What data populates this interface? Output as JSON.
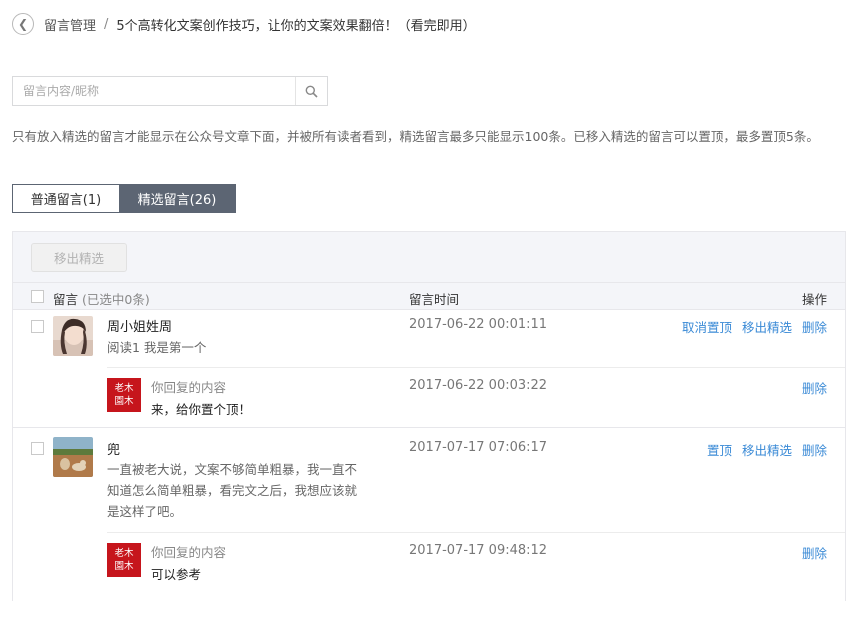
{
  "breadcrumb": {
    "parent": "留言管理",
    "separator": "/",
    "current": "5个高转化文案创作技巧，让你的文案效果翻倍！（看完即用）"
  },
  "search": {
    "placeholder": "留言内容/昵称",
    "value": ""
  },
  "notice": "只有放入精选的留言才能显示在公众号文章下面，并被所有读者看到，精选留言最多只能显示100条。已移入精选的留言可以置顶，最多置顶5条。",
  "tabs": [
    {
      "label": "普通留言(1)",
      "active": false
    },
    {
      "label": "精选留言(26)",
      "active": true
    }
  ],
  "toolbar": {
    "remove_label": "移出精选"
  },
  "table": {
    "header_message": "留言",
    "header_selected": "(已选中0条)",
    "header_time": "留言时间",
    "header_ops": "操作"
  },
  "comments": [
    {
      "nickname": "周小姐姓周",
      "message": "阅读1 我是第一个",
      "time": "2017-06-22 00:01:11",
      "ops": [
        "取消置顶",
        "移出精选",
        "删除"
      ],
      "reply": {
        "avatar_text": [
          "老木",
          "園木"
        ],
        "label": "你回复的内容",
        "text": "来，给你置个顶！",
        "time": "2017-06-22 00:03:22",
        "op": "删除"
      }
    },
    {
      "nickname": "兜",
      "message_lines": [
        "一直被老大说，文案不够简单粗暴，我一直不",
        "知道怎么简单粗暴，看完文之后，我想应该就",
        "是这样了吧。"
      ],
      "time": "2017-07-17 07:06:17",
      "ops": [
        "置顶",
        "移出精选",
        "删除"
      ],
      "reply": {
        "avatar_text": [
          "老木",
          "園木"
        ],
        "label": "你回复的内容",
        "text": "可以参考",
        "time": "2017-07-17 09:48:12",
        "op": "删除"
      }
    }
  ],
  "colors": {
    "tab_active": "#5c6573",
    "link": "#3a8ad6",
    "reply_avatar": "#c6151c"
  },
  "icons": {
    "back": "chevron-left-icon",
    "search": "search-icon"
  }
}
